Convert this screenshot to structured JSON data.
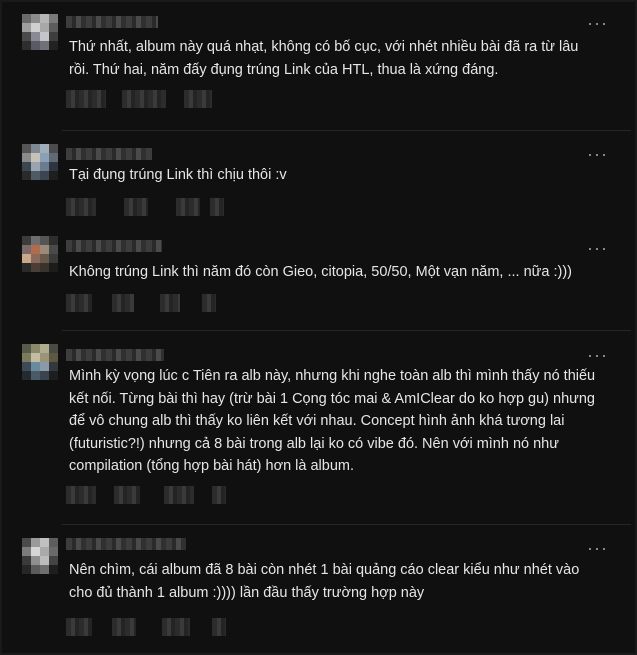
{
  "comments": [
    {
      "text": "Thứ nhất, album này quá nhạt, không có bố cục, với nhét nhiều bài đã ra từ lâu rồi. Thứ hai, năm đấy đụng trúng Link của HTL, thua là xứng đáng.",
      "more": "···"
    },
    {
      "text": "Tại đụng trúng Link thì chịu thôi :v",
      "more": "···"
    },
    {
      "text": "Không trúng Link thì năm đó còn Gieo, citopia, 50/50, Một vạn năm, ... nữa :)))",
      "more": "···"
    },
    {
      "text": "Mình kỳ vọng lúc c Tiên ra alb này, nhưng khi nghe toàn alb thì mình thấy nó thiếu kết nối. Từng bài thì hay (trừ bài 1 Cọng tóc mai & AmIClear do ko hợp gu) nhưng để vô chung alb thì thấy ko liên kết với nhau. Concept hình ảnh khá tương lai (futuristic?!) nhưng cả 8 bài trong alb lại ko có vibe đó. Nên với mình nó như compilation (tổng hợp bài hát) hơn là album.",
      "more": "···"
    },
    {
      "text": "Nên chìm, cái album đã 8 bài còn nhét 1 bài quảng cáo clear kiểu như nhét vào cho đủ thành 1 album :)))) lần đầu thấy trường hợp này",
      "more": "···"
    }
  ]
}
